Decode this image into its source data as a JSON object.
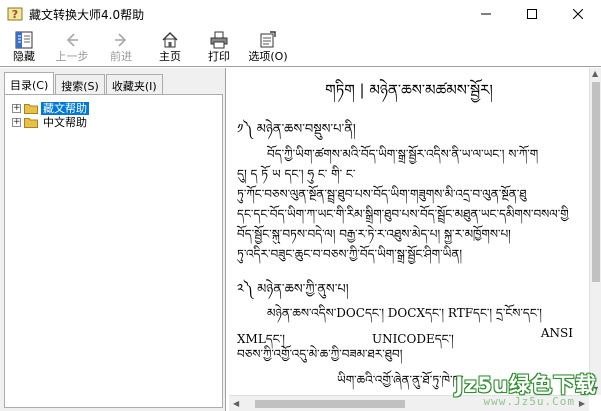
{
  "window": {
    "title": "藏文转换大师4.0帮助"
  },
  "toolbar": {
    "buttons": [
      {
        "id": "hide",
        "label": "隐藏",
        "icon": "hide-pane-icon",
        "enabled": true
      },
      {
        "id": "back",
        "label": "上一步",
        "icon": "back-arrow-icon",
        "enabled": false
      },
      {
        "id": "forward",
        "label": "前进",
        "icon": "forward-arrow-icon",
        "enabled": false
      },
      {
        "id": "home",
        "label": "主页",
        "icon": "home-icon",
        "enabled": true
      },
      {
        "id": "print",
        "label": "打印",
        "icon": "printer-icon",
        "enabled": true
      },
      {
        "id": "options",
        "label": "选项(O)",
        "icon": "options-icon",
        "enabled": true
      }
    ]
  },
  "nav": {
    "tabs": [
      "目录(C)",
      "搜索(S)",
      "收藏夹(I)"
    ],
    "active_tab": "目录(C)",
    "tree": [
      {
        "label": "藏文帮助",
        "selected": true,
        "expanded": false
      },
      {
        "label": "中文帮助",
        "selected": false,
        "expanded": false
      }
    ]
  },
  "content": {
    "title": "གཏིག | མཉེན་ཆས་མཚམས་སྦྱོར།",
    "section1_heading": "༡༽ མཉེན་ཆས་བསྡུས་པ་ནི།",
    "section1_lines": [
      "བོད་ཀྱི་ཡིག་ཚགས་མའི་བོད་ཡིག་སྒྲ་སྦྱོར་འདིས་ནི་ཡ་ལ་ཡང་།   ས་ཀོ་ག",
      "དུ།   ད   ཏོ   ཡ   དང་།   ཧུ   ང་   གི་   ང་",
      "ཏུ་ཀོང་བཅས་ལུན་སྔོན་སྦྲ་ཐུབ་པས་བོད་ཡིག་གཟུགས་མི་འདྲ་བ་ལུན་སྔོན་ཐུ",
      "དང་དང་བོད་ཡིག་ཀ་ཡང་གི་རིམ་སྒྲིག་ཐུབ་པས་བོད་སྦྲོང་མཐུན་ཡང་དམིགས་བསལ་གྱི",
      "བོད་སྦྱོང་སྐུ་བཏས་བདེ་ལ། བརྒྱ་ར་ཏེ་ར་འཐུས་མེད་པ། སྐྱ་ར་མཁྱོགས་པ།",
      "ཏུ་འདིར་བཟུང་ཆུང་བ་བཅས་ཀྱི་བོད་ཡིག་སྒྲ་སྦྱོང་ཤིག་ཡིན།"
    ],
    "section2_heading": "༢༽ མཉེན་ཆས་ཀྱི་ནུས་པ།",
    "section2_line1": "མཉེན་ཆས་འདིས་DOCདང་།   DOCXདང་།   RTFདང་།   དྲ་ངོས་དང་།",
    "section2_line2_parts": [
      "XMLདང་།",
      "UNICODEདང་།",
      "ANSI"
    ],
    "section2_line3": "བཅས་ཀྱི་འགྱོ་འདུ་མེ་ཆ་ཀྱི་བཟམ་ཐར་ཐུབ།",
    "section2_line4": "ཡིག་ཆའི་འགྱོ་ཞེན་ནུ་ཐོ་ཏུ་ཁེ་ཁ་"
  },
  "watermark": {
    "main": "Jz5u绿色下载",
    "sub": "www.Jz5u.Com"
  },
  "colors": {
    "selection": "#0078d7",
    "folder": "#e8c048",
    "watermark": "#2e8b2e"
  }
}
